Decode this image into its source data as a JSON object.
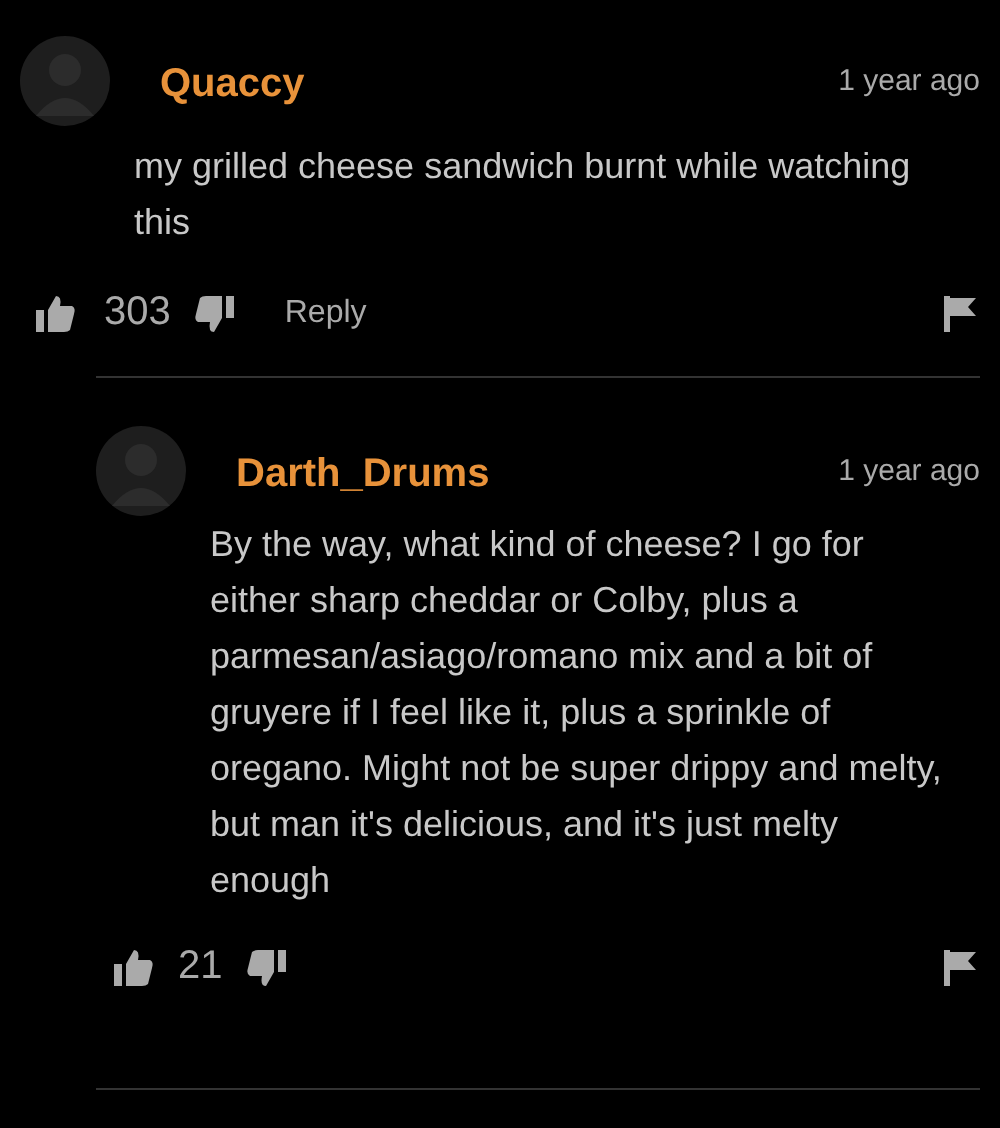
{
  "comments": [
    {
      "username": "Quaccy",
      "time": "1 year ago",
      "text": "my grilled cheese sandwich burnt while watching this",
      "likes": "303",
      "reply_label": "Reply",
      "replies": [
        {
          "username": "Darth_Drums",
          "time": "1 year ago",
          "text": "By the way, what kind of cheese? I go for either sharp cheddar or Colby, plus a parmesan/asiago/romano mix and a bit of gruyere if I feel like it, plus a sprinkle of oregano. Might not be super drippy and melty, but man it's delicious, and it's just melty enough",
          "likes": "21"
        }
      ]
    }
  ]
}
